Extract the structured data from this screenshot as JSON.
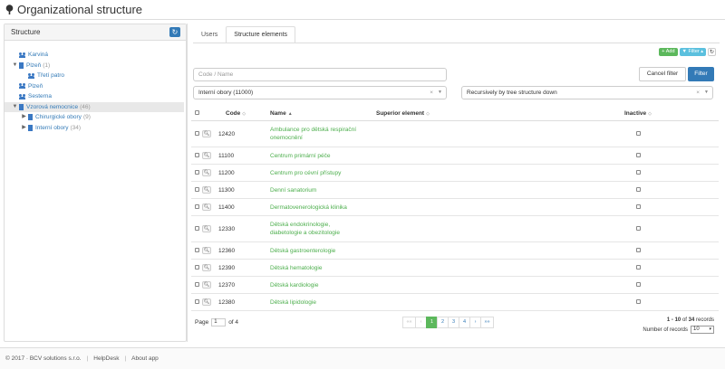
{
  "page": {
    "title": "Organizational structure"
  },
  "structure": {
    "label": "Structure",
    "tree": [
      {
        "label": "Karviná",
        "count": "",
        "level": 0,
        "toggle": "",
        "icon": "users"
      },
      {
        "label": "Plzeň",
        "count": "(1)",
        "level": 0,
        "toggle": "▼",
        "icon": "building"
      },
      {
        "label": "Třetí patro",
        "count": "",
        "level": 1,
        "toggle": "",
        "icon": "users"
      },
      {
        "label": "Plzeň",
        "count": "",
        "level": 0,
        "toggle": "",
        "icon": "users"
      },
      {
        "label": "Sesterna",
        "count": "",
        "level": 0,
        "toggle": "",
        "icon": "users"
      },
      {
        "label": "Vzorová nemocnice",
        "count": "(46)",
        "level": 0,
        "toggle": "▼",
        "icon": "building",
        "selected": true
      },
      {
        "label": "Chirurgické obory",
        "count": "(9)",
        "level": 1,
        "toggle": "▶",
        "icon": "building"
      },
      {
        "label": "Interní obory",
        "count": "(34)",
        "level": 1,
        "toggle": "▶",
        "icon": "building"
      }
    ]
  },
  "tabs": [
    {
      "label": "Users",
      "active": false
    },
    {
      "label": "Structure elements",
      "active": true
    }
  ],
  "toolbar": {
    "add_label": "+ Add",
    "filter_label": "▼ Filter ▴",
    "refresh_icon": "refresh-icon"
  },
  "filter": {
    "search_placeholder": "Code / Name",
    "parent_value": "Interní obory (11000)",
    "recursion_value": "Recursively by tree structure down",
    "cancel_label": "Cancel filter",
    "apply_label": "Filter"
  },
  "grid": {
    "headers": {
      "code": "Code",
      "name": "Name",
      "superior": "Superior element",
      "inactive": "Inactive"
    },
    "rows": [
      {
        "code": "12420",
        "name_line1": "Ambulance pro dětská respirační",
        "name_line2": "onemocnění"
      },
      {
        "code": "11100",
        "name_line1": "Centrum primární péče",
        "name_line2": ""
      },
      {
        "code": "11200",
        "name_line1": "Centrum pro cévní přístupy",
        "name_line2": ""
      },
      {
        "code": "11300",
        "name_line1": "Denní sanatorium",
        "name_line2": ""
      },
      {
        "code": "11400",
        "name_line1": "Dermatovenerologická klinika",
        "name_line2": ""
      },
      {
        "code": "12330",
        "name_line1": "Dětská endokrinologie,",
        "name_line2": "diabetologie a obezitologie"
      },
      {
        "code": "12360",
        "name_line1": "Dětská gastroenterologie",
        "name_line2": ""
      },
      {
        "code": "12390",
        "name_line1": "Dětská hematologie",
        "name_line2": ""
      },
      {
        "code": "12370",
        "name_line1": "Dětská kardiologie",
        "name_line2": ""
      },
      {
        "code": "12380",
        "name_line1": "Dětská lipidologie",
        "name_line2": ""
      }
    ]
  },
  "pager": {
    "page_label": "Page",
    "page_value": "1",
    "of_label": "of 4",
    "buttons": [
      "««",
      "‹",
      "1",
      "2",
      "3",
      "4",
      "›",
      "»»"
    ],
    "records_range": "1 - 10",
    "records_of": "of",
    "records_total": "34",
    "records_suffix": "records",
    "num_records_label": "Number of records",
    "num_records_value": "10"
  },
  "footer": {
    "copyright": "© 2017 · BCV solutions s.r.o.",
    "helpdesk": "HelpDesk",
    "about": "About app"
  }
}
